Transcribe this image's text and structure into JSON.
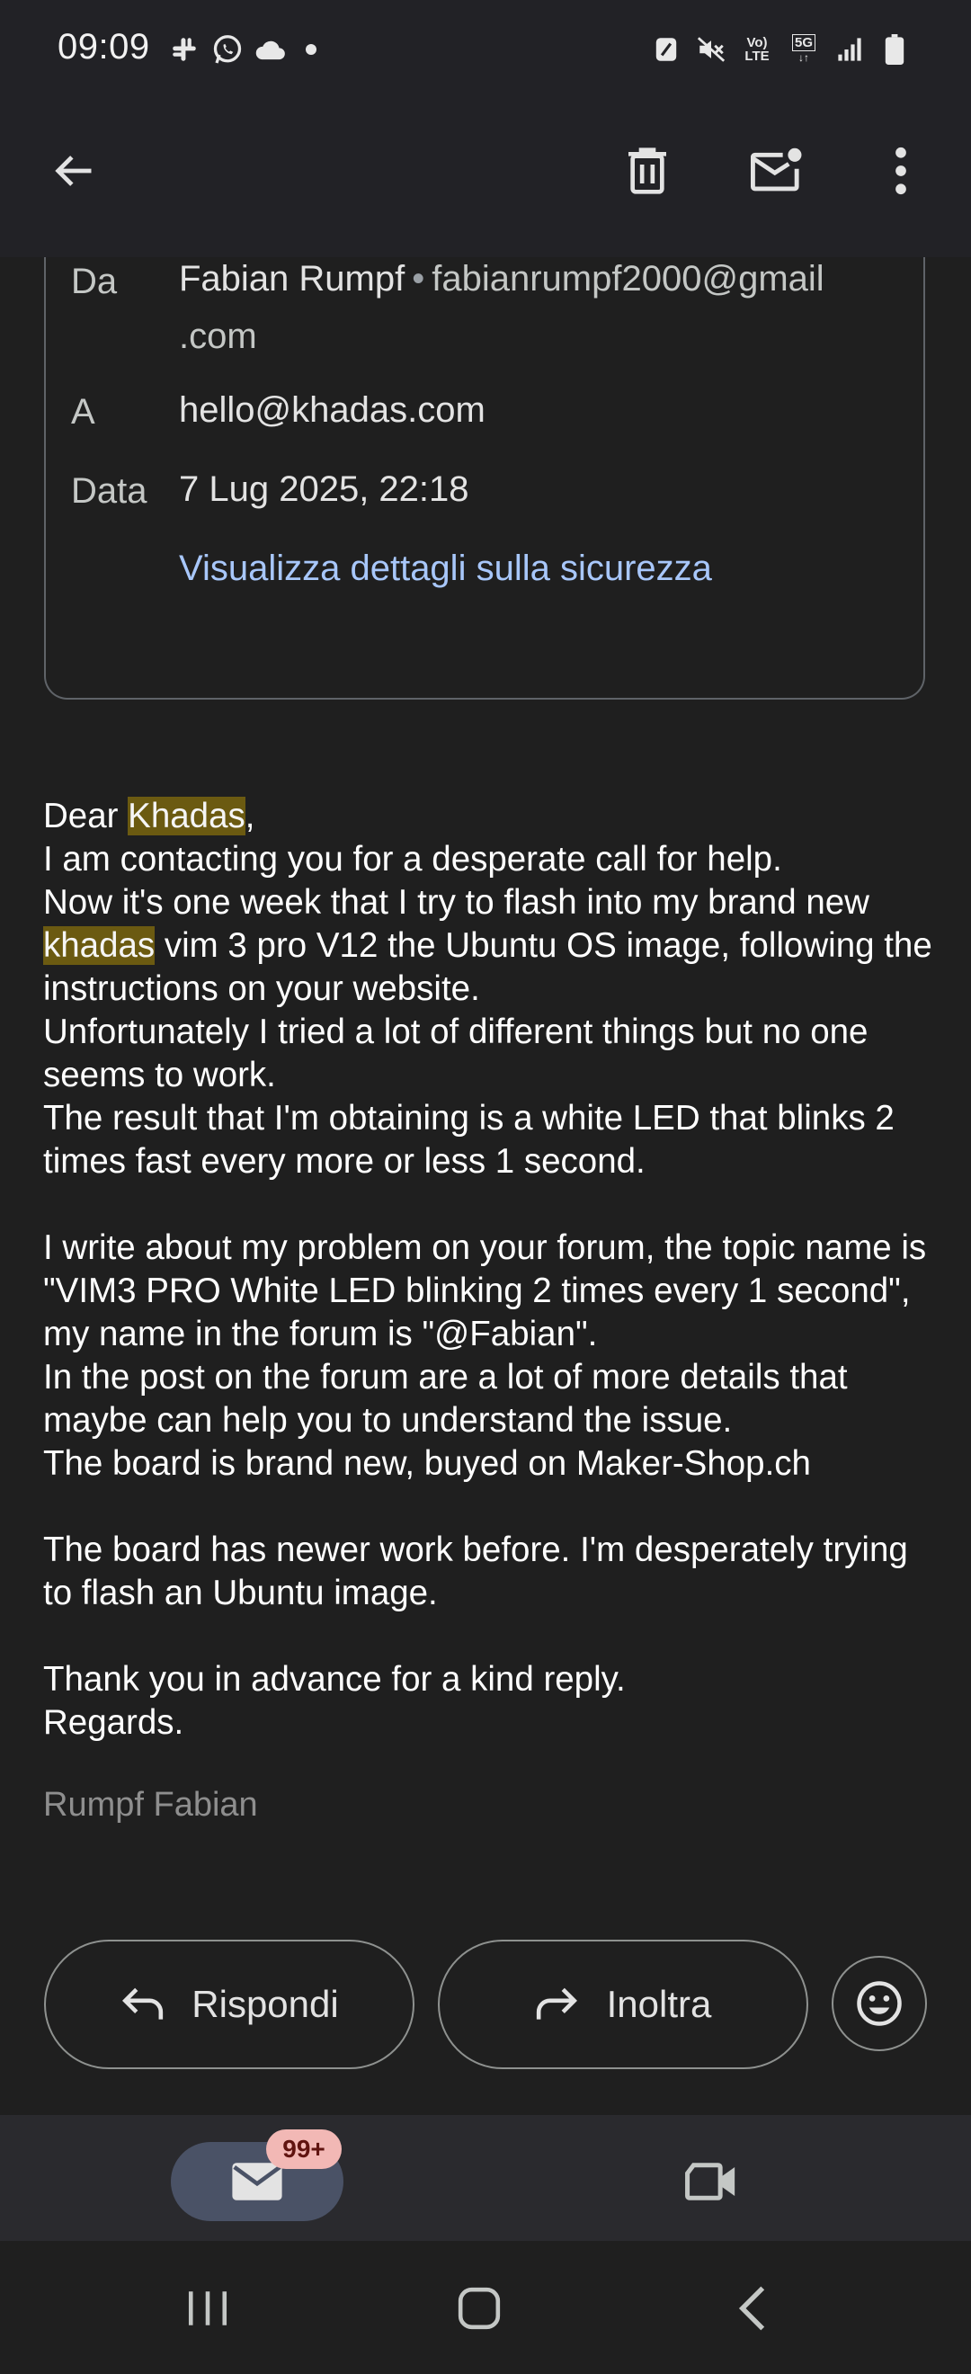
{
  "status_bar": {
    "time": "09:09",
    "left_icons": [
      "slack-icon",
      "whatsapp-icon",
      "cloud-icon",
      "notification-dot-icon"
    ],
    "right_icons": [
      "nfc-icon",
      "mute-icon",
      "volte-icon",
      "5g-icon",
      "signal-icon",
      "battery-icon"
    ],
    "volte_label": "Vo) LTE",
    "fiveg_label": "5G"
  },
  "app_bar": {
    "icons": [
      "back-arrow-icon",
      "trash-icon",
      "mark-unread-icon",
      "more-vert-icon"
    ]
  },
  "details": {
    "from_label": "Da",
    "from_name": "Fabian Rumpf",
    "separator": "•",
    "from_email_line1": "fabianrumpf2000@gmail",
    "from_email_line2": ".com",
    "to_label": "A",
    "to_value": "hello@khadas.com",
    "date_label": "Data",
    "date_value": "7 Lug 2025, 22:18",
    "security_link": "Visualizza dettagli sulla sicurezza"
  },
  "body": {
    "greeting_prefix": "Dear ",
    "greeting_highlight": "Khadas",
    "greeting_suffix": ",",
    "line1": "I am contacting you for a desperate call for help.",
    "line2": "Now it's one week that I try to flash into my brand new",
    "line3_highlight": "khadas",
    "line3_rest": " vim 3 pro V12 the Ubuntu OS image, following the instructions on your website.",
    "para1b": "Unfortunately I tried a lot of different things but no one seems to work.\nThe result that I'm obtaining is a white LED that blinks 2 times fast every more or less 1 second.",
    "para2": "I write about my problem on your forum, the topic name is \"VIM3 PRO White LED blinking 2 times every 1 second\", my name in the forum is \"@Fabian\".\nIn the post on the forum are a lot of more details that maybe can help you to understand the issue.\nThe board is brand new, buyed on Maker-Shop.ch",
    "para3": "The board has newer work before. I'm desperately trying to flash an Ubuntu image.",
    "para4": "Thank you in advance for a kind reply.\nRegards."
  },
  "signature": "Rumpf Fabian",
  "actions": {
    "reply_label": "Rispondi",
    "forward_label": "Inoltra",
    "emoji_icon": "emoji-reaction-icon"
  },
  "bottom_nav": {
    "mail_badge": "99+",
    "icons": [
      "mail-icon",
      "meet-video-icon"
    ]
  },
  "system_nav": {
    "icons": [
      "recents-icon",
      "home-icon",
      "back-icon"
    ]
  }
}
